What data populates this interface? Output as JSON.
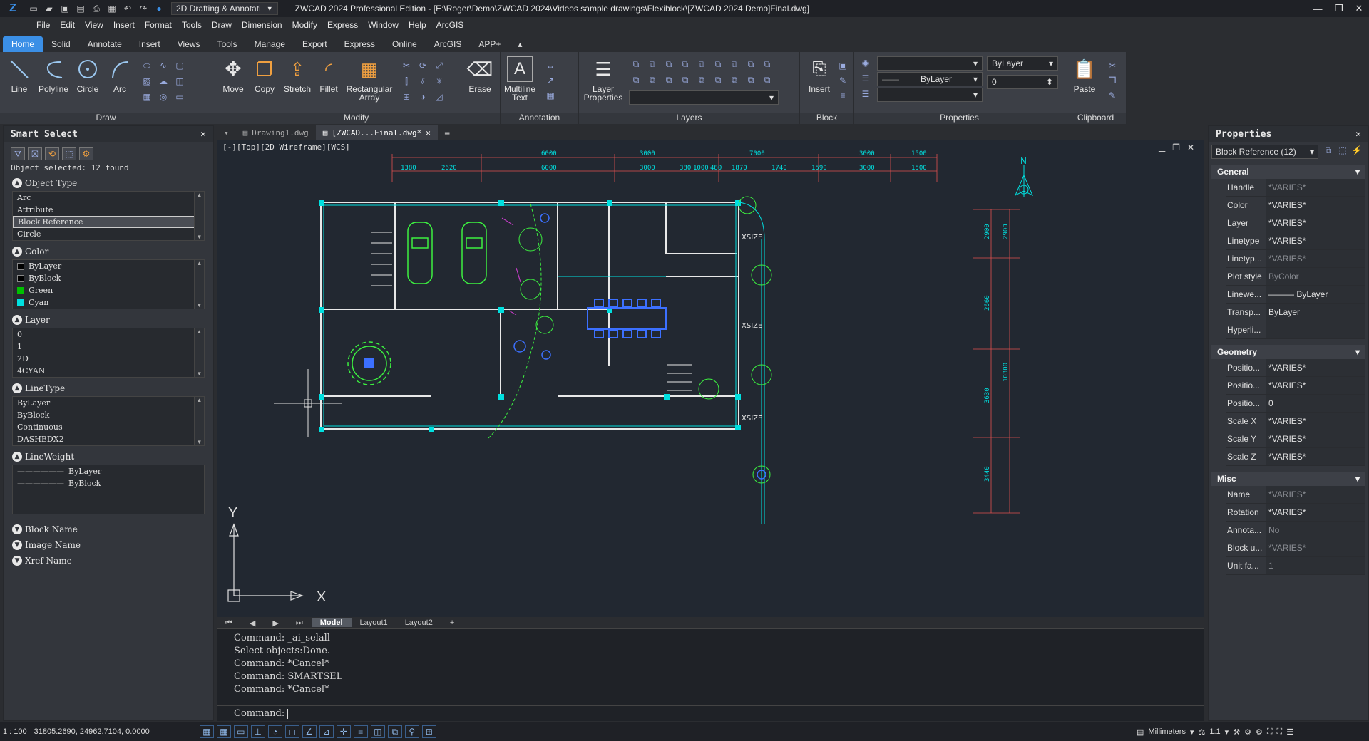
{
  "titlebar": {
    "workspace": "2D Drafting & Annotati",
    "title": "ZWCAD 2024 Professional Edition - [E:\\Roger\\Demo\\ZWCAD 2024\\Videos sample drawings\\Flexiblock\\[ZWCAD 2024 Demo]Final.dwg]"
  },
  "menu": [
    "File",
    "Edit",
    "View",
    "Insert",
    "Format",
    "Tools",
    "Draw",
    "Dimension",
    "Modify",
    "Express",
    "Window",
    "Help",
    "ArcGIS"
  ],
  "ribbon_tabs": [
    "Home",
    "Solid",
    "Annotate",
    "Insert",
    "Views",
    "Tools",
    "Manage",
    "Export",
    "Express",
    "Online",
    "ArcGIS",
    "APP+"
  ],
  "ribbon": {
    "draw": {
      "title": "Draw",
      "line": "Line",
      "polyline": "Polyline",
      "circle": "Circle",
      "arc": "Arc"
    },
    "modify": {
      "title": "Modify",
      "move": "Move",
      "copy": "Copy",
      "stretch": "Stretch",
      "fillet": "Fillet",
      "rect_array": "Rectangular Array",
      "erase": "Erase"
    },
    "annotation": {
      "title": "Annotation",
      "mtext": "Multiline Text"
    },
    "layers": {
      "title": "Layers",
      "layer_props": "Layer Properties"
    },
    "block": {
      "title": "Block",
      "insert": "Insert"
    },
    "properties": {
      "title": "Properties",
      "color": "ByLayer",
      "linetype": "ByLayer",
      "lineweight": "0"
    },
    "clipboard": {
      "title": "Clipboard",
      "paste": "Paste"
    }
  },
  "smart_select": {
    "title": "Smart Select",
    "status": "Object selected: 12 found",
    "sections": {
      "object_type": {
        "label": "Object Type",
        "items": [
          "Arc",
          "Attribute",
          "Block Reference",
          "Circle"
        ]
      },
      "color": {
        "label": "Color",
        "items": [
          "ByLayer",
          "ByBlock",
          "Green",
          "Cyan"
        ]
      },
      "layer": {
        "label": "Layer",
        "items": [
          "0",
          "1",
          "2D",
          "4CYAN"
        ]
      },
      "linetype": {
        "label": "LineType",
        "items": [
          "ByLayer",
          "ByBlock",
          "Continuous",
          "DASHEDX2"
        ]
      },
      "lineweight": {
        "label": "LineWeight",
        "items": [
          "ByLayer",
          "ByBlock"
        ]
      },
      "block_name": "Block Name",
      "image_name": "Image Name",
      "xref_name": "Xref Name"
    }
  },
  "doc_tabs": [
    "Drawing1.dwg",
    "[ZWCAD...Final.dwg*"
  ],
  "view_label": "[-][Top][2D Wireframe][WCS]",
  "cad": {
    "dims_top": [
      "6000",
      "3000",
      "7000",
      "3000",
      "1500"
    ],
    "dims_bot": [
      "1380",
      "2620",
      "6000",
      "3000",
      "380",
      "1000",
      "480",
      "1870",
      "1740",
      "1590",
      "3000",
      "1500"
    ],
    "dims_right_inner": [
      "2900",
      "2660",
      "3630",
      "3440"
    ],
    "dims_right_outer": [
      "2900",
      "10300"
    ],
    "size_label": "XSIZE",
    "north": "N",
    "ucs_x": "X",
    "ucs_y": "Y"
  },
  "layout_tabs": [
    "Model",
    "Layout1",
    "Layout2",
    "+"
  ],
  "command": {
    "history": [
      "Command: _ai_selall",
      "Select objects:Done.",
      "Command: *Cancel*",
      "Command: SMARTSEL",
      "Command: *Cancel*"
    ],
    "prompt": "Command:"
  },
  "properties": {
    "title": "Properties",
    "selection": "Block Reference (12)",
    "groups": [
      {
        "name": "General",
        "rows": [
          [
            "Handle",
            "*VARIES*",
            true
          ],
          [
            "Color",
            "*VARIES*",
            false
          ],
          [
            "Layer",
            "*VARIES*",
            false
          ],
          [
            "Linetype",
            "*VARIES*",
            false
          ],
          [
            "Linetyp...",
            "*VARIES*",
            true
          ],
          [
            "Plot style",
            "ByColor",
            true
          ],
          [
            "Linewe...",
            "——— ByLayer",
            false
          ],
          [
            "Transp...",
            "ByLayer",
            false
          ],
          [
            "Hyperli...",
            "",
            false
          ]
        ]
      },
      {
        "name": "Geometry",
        "rows": [
          [
            "Positio...",
            "*VARIES*",
            false
          ],
          [
            "Positio...",
            "*VARIES*",
            false
          ],
          [
            "Positio...",
            "0",
            false
          ],
          [
            "Scale X",
            "*VARIES*",
            false
          ],
          [
            "Scale Y",
            "*VARIES*",
            false
          ],
          [
            "Scale Z",
            "*VARIES*",
            false
          ]
        ]
      },
      {
        "name": "Misc",
        "rows": [
          [
            "Name",
            "*VARIES*",
            true
          ],
          [
            "Rotation",
            "*VARIES*",
            false
          ],
          [
            "Annota...",
            "No",
            true
          ],
          [
            "Block u...",
            "*VARIES*",
            true
          ],
          [
            "Unit fa...",
            "1",
            true
          ]
        ]
      }
    ]
  },
  "status": {
    "scale": "1 : 100",
    "coords": "31805.2690, 24962.7104, 0.0000",
    "units": "Millimeters",
    "anno_scale": "1:1"
  }
}
